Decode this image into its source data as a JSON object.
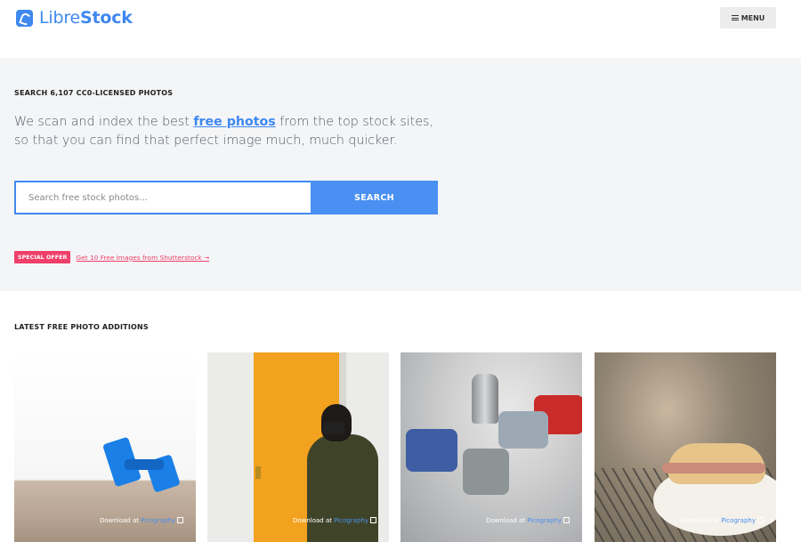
{
  "header": {
    "logo_light": "Libre",
    "logo_bold": "Stock",
    "menu_label": "MENU"
  },
  "hero": {
    "eyebrow": "SEARCH 6,107 CC0-LICENSED PHOTOS",
    "text_before": "We scan and index the best ",
    "text_link": "free photos",
    "text_after": " from the top stock sites, so that you can find that perfect image much, much quicker.",
    "search_placeholder": "Search free stock photos...",
    "search_button": "SEARCH",
    "offer_badge": "SPECIAL OFFER",
    "offer_link": "Get 10 Free Images from Shutterstock →"
  },
  "latest": {
    "title": "LATEST FREE PHOTO ADDITIONS",
    "cards": [
      {
        "prefix": "Download at ",
        "source": "Picography"
      },
      {
        "prefix": "Download at ",
        "source": "Picography"
      },
      {
        "prefix": "Download at ",
        "source": "Picography"
      },
      {
        "prefix": "Download at ",
        "source": "Picography"
      }
    ]
  },
  "colors": {
    "brand": "#3e88f0",
    "offer": "#ef3f6a",
    "hero_bg": "#f4f5f7"
  },
  "icons": [
    "logo-icon",
    "hamburger-icon",
    "external-link-icon"
  ]
}
